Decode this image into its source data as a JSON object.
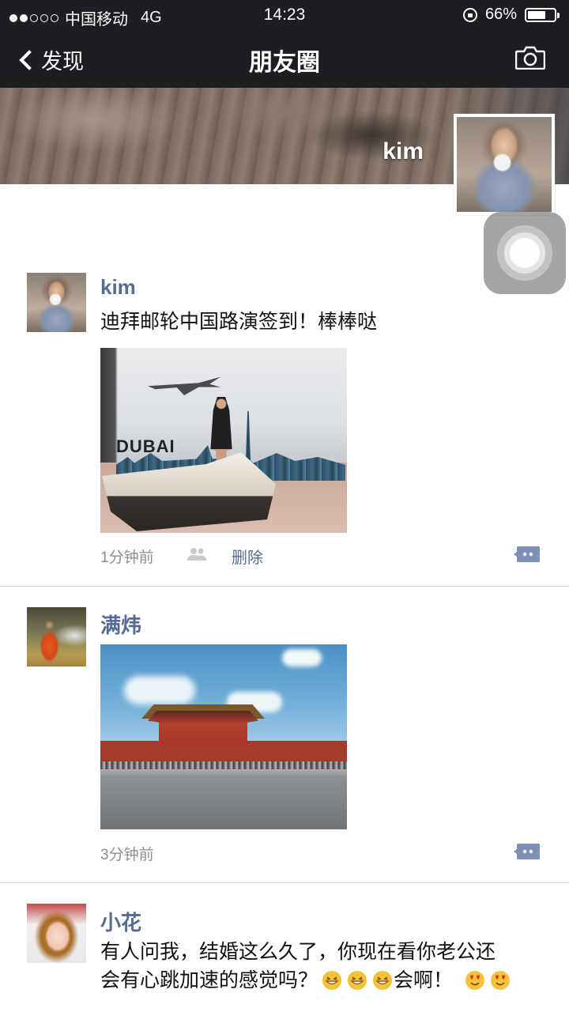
{
  "status_bar": {
    "carrier": "中国移动",
    "network": "4G",
    "time": "14:23",
    "battery": "66%",
    "signal_bars_filled": 2,
    "signal_bars_total": 5
  },
  "nav": {
    "back_label": "发现",
    "title": "朋友圈",
    "right_icon": "camera-icon"
  },
  "profile": {
    "name": "kim"
  },
  "posts": [
    {
      "author": "kim",
      "text": "迪拜邮轮中国路演签到！棒棒哒",
      "photo_caption": "DUBAI",
      "time": "1分钟前",
      "delete_label": "删除"
    },
    {
      "author": "满炜",
      "text": "",
      "time": "3分钟前"
    },
    {
      "author": "小花",
      "text_line1": "有人问我，结婚这么久了，你现在看你老公还",
      "text_line2": "会有心跳加速的感觉吗？",
      "text_line2_after": "会啊！"
    }
  ],
  "colors": {
    "nav_bg": "#1e1d22",
    "link": "#576b95",
    "time_text": "#8e8e8e",
    "divider": "#dcdcdc"
  }
}
